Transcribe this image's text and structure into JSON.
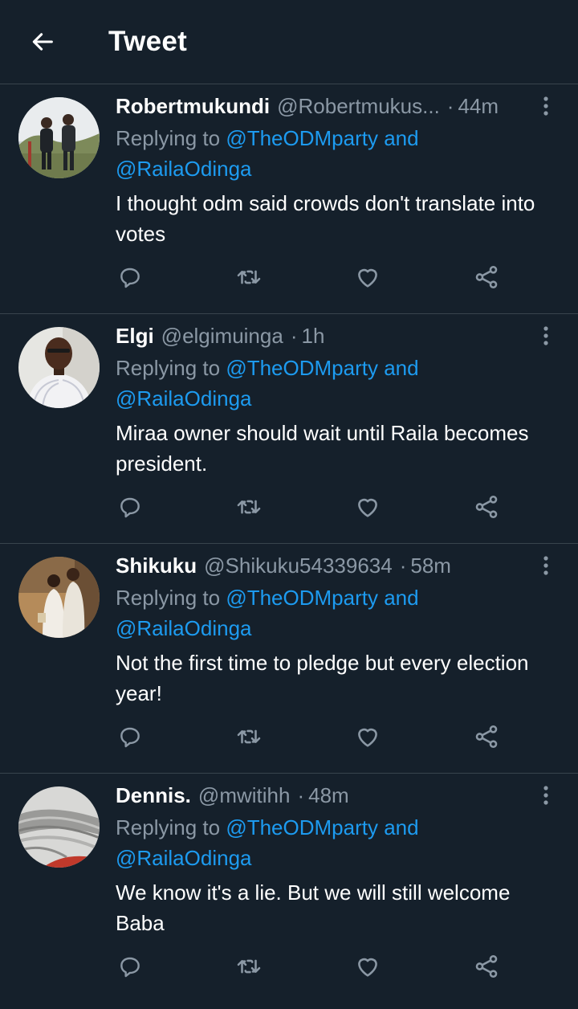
{
  "header": {
    "title": "Tweet"
  },
  "tweets": [
    {
      "name": "Robertmukundi",
      "handle": "@Robertmukus...",
      "time": "44m",
      "replying_prefix": "Replying to",
      "mention_1": "@TheODMparty",
      "and_word": "and",
      "mention_2": "@RailaOdinga",
      "text": "I thought odm said crowds don't translate into votes"
    },
    {
      "name": "Elgi",
      "handle": "@elgimuinga",
      "time": "1h",
      "replying_prefix": "Replying to",
      "mention_1": "@TheODMparty",
      "and_word": "and",
      "mention_2": "@RailaOdinga",
      "text": "Miraa owner should wait until Raila becomes president."
    },
    {
      "name": "Shikuku",
      "handle": "@Shikuku54339634",
      "time": "58m",
      "replying_prefix": "Replying to",
      "mention_1": "@TheODMparty",
      "and_word": "and",
      "mention_2": "@RailaOdinga",
      "text": "Not the first time to pledge but every election year!"
    },
    {
      "name": "Dennis.",
      "handle": "@mwitihh",
      "time": "48m",
      "replying_prefix": "Replying to",
      "mention_1": "@TheODMparty",
      "and_word": "and",
      "mention_2": "@RailaOdinga",
      "text": "We know it's a lie. But we will still welcome Baba"
    }
  ],
  "icons": {
    "back": "arrow-left-icon",
    "more": "more-vertical-icon",
    "reply": "reply-bubble-icon",
    "retweet": "retweet-icon",
    "like": "heart-icon",
    "share": "share-icon"
  },
  "colors": {
    "background": "#15202b",
    "divider": "#38444d",
    "secondary_text": "#8b98a5",
    "link": "#1d9bf0"
  }
}
